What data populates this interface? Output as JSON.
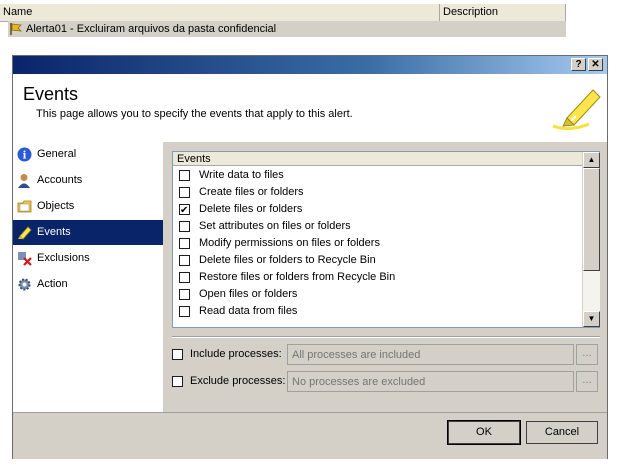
{
  "list": {
    "columns": [
      "Name",
      "Description"
    ],
    "row": {
      "name": "Alerta01 - Excluiram arquivos da pasta confidencial",
      "icon": "alert-flag-icon"
    }
  },
  "dialog": {
    "help_label": "?",
    "close_label": "✕",
    "title": "Events",
    "description": "This page allows you to specify the events that apply to this alert.",
    "banner_icon": "highlighter-pen-icon",
    "accent": "#0a246a",
    "nav": [
      {
        "label": "General",
        "icon": "info-icon",
        "selected": false
      },
      {
        "label": "Accounts",
        "icon": "user-icon",
        "selected": false
      },
      {
        "label": "Objects",
        "icon": "folder-icon",
        "selected": false
      },
      {
        "label": "Events",
        "icon": "highlighter-icon",
        "selected": true
      },
      {
        "label": "Exclusions",
        "icon": "exclusion-icon",
        "selected": false
      },
      {
        "label": "Action",
        "icon": "gear-icon",
        "selected": false
      }
    ],
    "events_header": "Events",
    "events": [
      {
        "label": "Write data to files",
        "checked": false
      },
      {
        "label": "Create files or folders",
        "checked": false
      },
      {
        "label": "Delete files or folders",
        "checked": true
      },
      {
        "label": "Set attributes on files or folders",
        "checked": false
      },
      {
        "label": "Modify permissions on files or folders",
        "checked": false
      },
      {
        "label": "Delete files or folders to Recycle Bin",
        "checked": false
      },
      {
        "label": "Restore files or folders from Recycle Bin",
        "checked": false
      },
      {
        "label": "Open files or folders",
        "checked": false
      },
      {
        "label": "Read data from files",
        "checked": false
      }
    ],
    "include": {
      "label": "Include processes:",
      "placeholder": "All processes are included",
      "browse": "..."
    },
    "exclude": {
      "label": "Exclude processes:",
      "placeholder": "No processes are excluded",
      "browse": "..."
    },
    "ok_label": "OK",
    "cancel_label": "Cancel"
  }
}
